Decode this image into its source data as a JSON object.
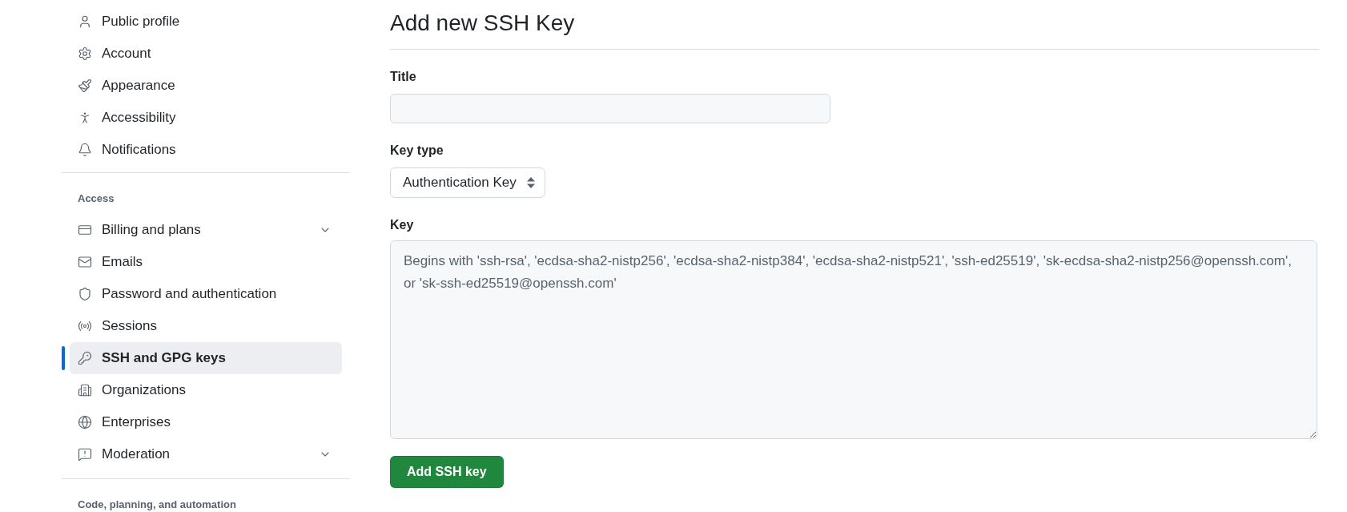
{
  "sidebar": {
    "sections": [
      {
        "items": [
          {
            "kind": "link",
            "label": "Public profile",
            "selected": false
          },
          {
            "kind": "link",
            "label": "Account",
            "selected": false
          },
          {
            "kind": "link",
            "label": "Appearance",
            "selected": false
          },
          {
            "kind": "link",
            "label": "Accessibility",
            "selected": false
          },
          {
            "kind": "link",
            "label": "Notifications",
            "selected": false
          }
        ]
      },
      {
        "heading": "Access",
        "items": [
          {
            "kind": "group",
            "label": "Billing and plans",
            "selected": false,
            "expanded": false
          },
          {
            "kind": "link",
            "label": "Emails",
            "selected": false
          },
          {
            "kind": "link",
            "label": "Password and authentication",
            "selected": false
          },
          {
            "kind": "link",
            "label": "Sessions",
            "selected": false
          },
          {
            "kind": "link",
            "label": "SSH and GPG keys",
            "selected": true
          },
          {
            "kind": "link",
            "label": "Organizations",
            "selected": false
          },
          {
            "kind": "link",
            "label": "Enterprises",
            "selected": false
          },
          {
            "kind": "group",
            "label": "Moderation",
            "selected": false,
            "expanded": false
          }
        ]
      },
      {
        "heading": "Code, planning, and automation"
      }
    ]
  },
  "form": {
    "heading": "Add new SSH Key",
    "fields": [
      {
        "kind": "text",
        "label": "Title"
      },
      {
        "kind": "select",
        "label": "Key type",
        "value": "Authentication Key"
      },
      {
        "kind": "textarea",
        "label": "Key",
        "placeholder": "Begins with 'ssh-rsa', 'ecdsa-sha2-nistp256', 'ecdsa-sha2-nistp384', 'ecdsa-sha2-nistp521', 'ssh-ed25519', 'sk-ecdsa-sha2-nistp256@openssh.com', or 'sk-ssh-ed25519@openssh.com'"
      }
    ],
    "submit": {
      "label": "Add SSH key"
    }
  }
}
